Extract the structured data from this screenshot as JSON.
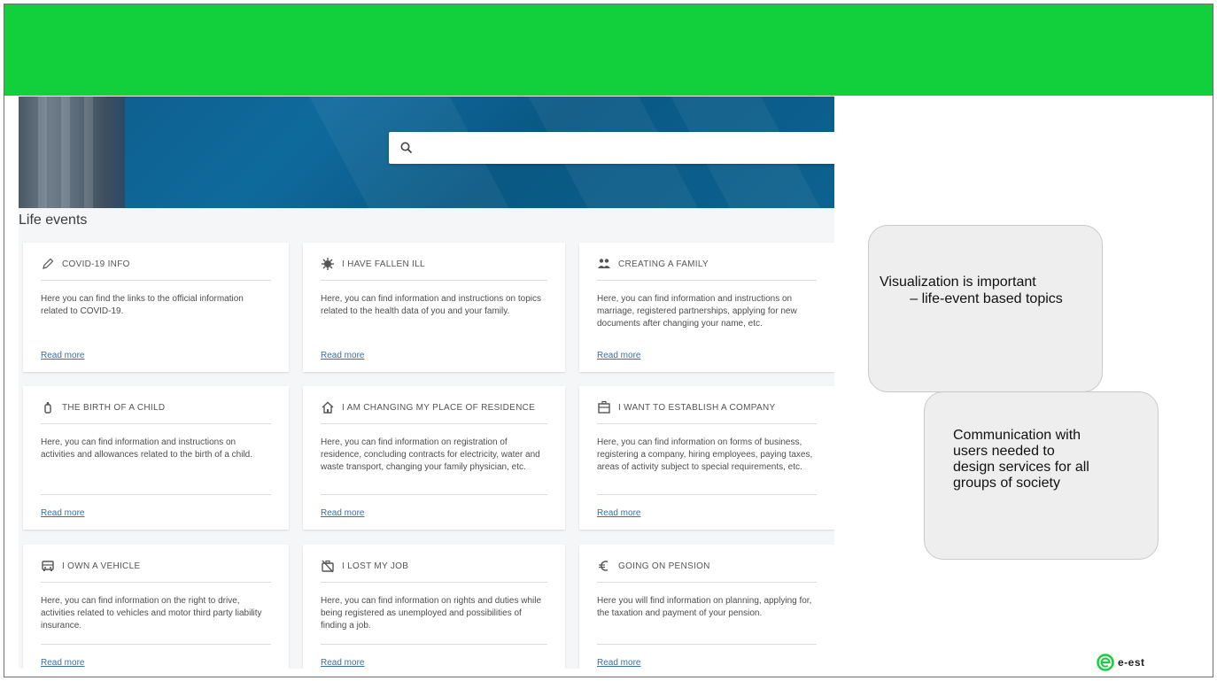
{
  "slide": {
    "header_color": "#12d03c",
    "bubbles": [
      {
        "line1": "Visualization is important",
        "line2": "– life-event based topics"
      },
      {
        "text": "Communication with\nusers needed to\ndesign services for all\ngroups of society"
      }
    ],
    "logo": {
      "icon": "e-estonia-logo-icon",
      "text": "e-est"
    }
  },
  "portal": {
    "search": {
      "placeholder": "",
      "icon": "search-icon"
    },
    "section_title": "Life events",
    "cards": [
      {
        "icon": "pencil-icon",
        "title": "COVID-19 INFO",
        "desc": "Here you can find the links to the official information related to COVID-19.",
        "link": "Read more"
      },
      {
        "icon": "virus-icon",
        "title": "I HAVE FALLEN ILL",
        "desc": "Here, you can find information and instructions on topics related to the health data of you and your family.",
        "link": "Read more"
      },
      {
        "icon": "family-icon",
        "title": "CREATING A FAMILY",
        "desc": "Here, you can find information and instructions on marriage, registered partnerships, applying for new documents after changing your name, etc.",
        "link": "Read more"
      },
      {
        "icon": "baby-bottle-icon",
        "title": "THE BIRTH OF A CHILD",
        "desc": "Here, you can find information and instructions on activities and allowances related to the birth of a child.",
        "link": "Read more"
      },
      {
        "icon": "house-icon",
        "title": "I AM CHANGING MY PLACE OF RESIDENCE",
        "desc": "Here, you can find information on registration of residence, concluding contracts for electricity, water and waste transport, changing your family physician, etc.",
        "link": "Read more"
      },
      {
        "icon": "building-icon",
        "title": "I WANT TO ESTABLISH A COMPANY",
        "desc": "Here, you can find information on forms of business, registering a company, hiring employees, paying taxes, areas of activity subject to special requirements, etc.",
        "link": "Read more"
      },
      {
        "icon": "car-icon",
        "title": "I OWN A VEHICLE",
        "desc": "Here, you can find information on the right to drive, activities related to vehicles and motor third party liability insurance.",
        "link": "Read more"
      },
      {
        "icon": "briefcase-off-icon",
        "title": "I LOST MY JOB",
        "desc": "Here, you can find information on rights and duties while being registered as unemployed and possibilities of finding a job.",
        "link": "Read more"
      },
      {
        "icon": "euro-icon",
        "title": "GOING ON PENSION",
        "desc": "Here you will find information on planning, applying for, the taxation and payment of your pension.",
        "link": "Read more"
      }
    ]
  }
}
